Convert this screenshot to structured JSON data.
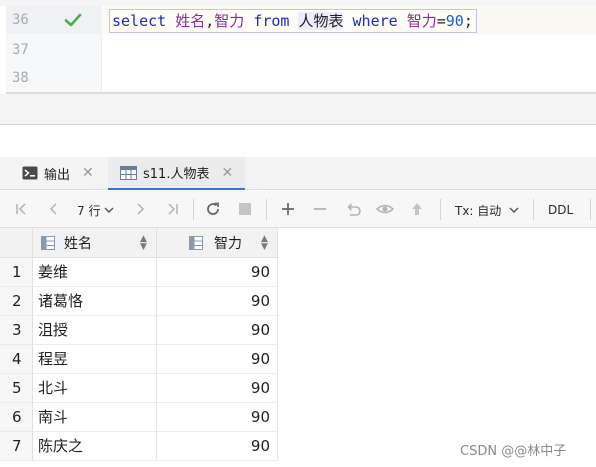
{
  "editor": {
    "lines": [
      {
        "number": "36",
        "current": true,
        "status": "check-icon"
      },
      {
        "number": "37",
        "current": false
      },
      {
        "number": "38",
        "current": false
      }
    ],
    "statement": {
      "kw_select": "select",
      "col1": "姓名",
      "comma": ",",
      "col2": "智力",
      "kw_from": "from",
      "table": "人物表",
      "kw_where": "where",
      "where_col": "智力",
      "op": "=",
      "value": "90",
      "semicolon": ";"
    }
  },
  "tabs": {
    "output": {
      "label": "输出",
      "icon": "console-icon"
    },
    "result": {
      "label": "s11.人物表",
      "icon": "table-icon"
    }
  },
  "toolbar": {
    "rows_label": "7 行",
    "tx_label": "Tx: 自动",
    "ddl_label": "DDL"
  },
  "grid": {
    "columns": [
      "姓名",
      "智力"
    ],
    "rows": [
      {
        "no": "1",
        "name": "姜维",
        "value": "90"
      },
      {
        "no": "2",
        "name": "诸葛恪",
        "value": "90"
      },
      {
        "no": "3",
        "name": "沮授",
        "value": "90"
      },
      {
        "no": "4",
        "name": "程昱",
        "value": "90"
      },
      {
        "no": "5",
        "name": "北斗",
        "value": "90"
      },
      {
        "no": "6",
        "name": "南斗",
        "value": "90"
      },
      {
        "no": "7",
        "name": "陈庆之",
        "value": "90"
      }
    ]
  },
  "watermark": "CSDN @@林中子",
  "colors": {
    "keyword": "#1d2bb8",
    "identifier": "#8b2aa0",
    "number": "#1a5fd1",
    "check": "#4caf50",
    "active_tab_underline": "#3b73d6"
  }
}
